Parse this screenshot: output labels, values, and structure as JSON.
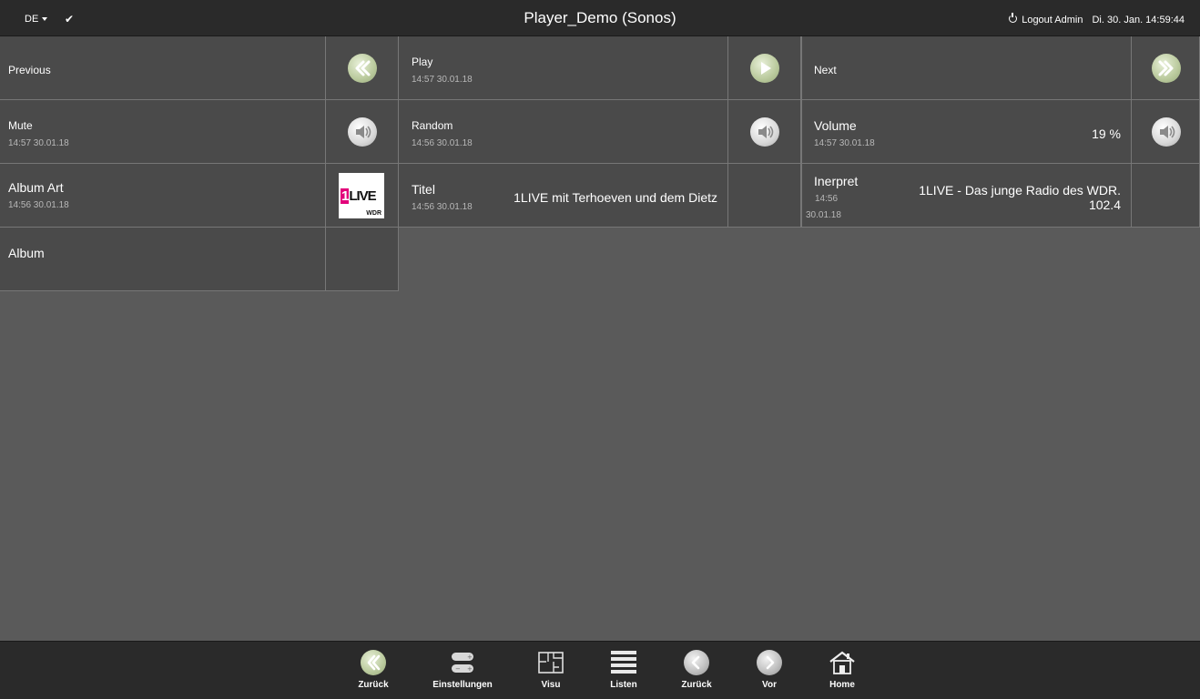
{
  "header": {
    "language": "DE",
    "check_icon": "check-icon",
    "title": "Player_Demo (Sonos)",
    "logout_label": "Logout Admin",
    "datetime": "Di. 30. Jan. 14:59:44"
  },
  "tiles": {
    "previous": {
      "label": "Previous",
      "icon": "rewind-icon"
    },
    "play": {
      "label": "Play",
      "timestamp": "14:57 30.01.18",
      "icon": "play-icon"
    },
    "next": {
      "label": "Next",
      "icon": "fast-forward-icon"
    },
    "mute": {
      "label": "Mute",
      "timestamp": "14:57 30.01.18",
      "icon": "speaker-icon"
    },
    "random": {
      "label": "Random",
      "timestamp": "14:56 30.01.18",
      "icon": "speaker-icon"
    },
    "volume": {
      "label": "Volume",
      "timestamp": "14:57 30.01.18",
      "value": "19 %",
      "icon": "speaker-icon"
    },
    "album_art": {
      "label": "Album Art",
      "timestamp": "14:56 30.01.18",
      "logo_text": "1LIVE",
      "logo_sub": "WDR"
    },
    "titel": {
      "label": "Titel",
      "timestamp": "14:56 30.01.18",
      "value": "1LIVE mit Terhoeven und dem Dietz"
    },
    "interpret": {
      "label": "Inerpret",
      "timestamp_time": "14:56",
      "timestamp_date": "30.01.18",
      "value_line1": "1LIVE - Das junge Radio des WDR.",
      "value_line2": "102.4"
    },
    "album": {
      "label": "Album"
    }
  },
  "footer": {
    "items": [
      {
        "label": "Zurück",
        "icon": "double-chevron-left-icon"
      },
      {
        "label": "Einstellungen",
        "icon": "settings-toggle-icon"
      },
      {
        "label": "Visu",
        "icon": "floorplan-icon"
      },
      {
        "label": "Listen",
        "icon": "list-icon"
      },
      {
        "label": "Zurück",
        "icon": "chevron-left-icon"
      },
      {
        "label": "Vor",
        "icon": "chevron-right-icon"
      },
      {
        "label": "Home",
        "icon": "home-icon"
      }
    ]
  },
  "colors": {
    "background": "#5a5a5a",
    "tile": "#4a4a4a",
    "bar": "#2a2a2a",
    "accent_green": "#b9c99c",
    "logo_pink": "#e2007a"
  }
}
